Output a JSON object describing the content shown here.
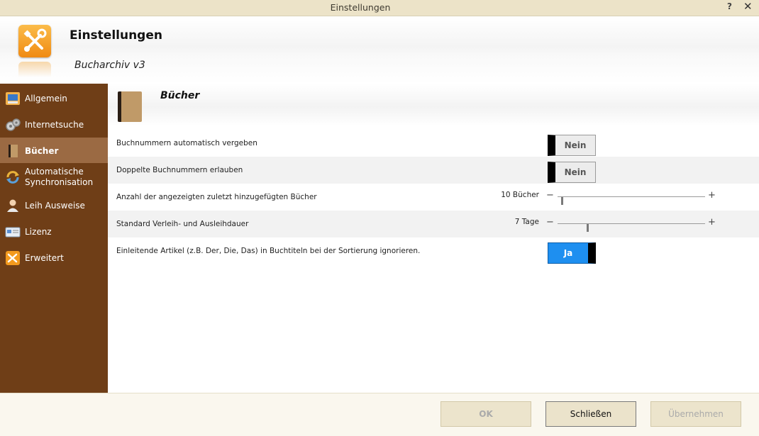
{
  "window": {
    "title": "Einstellungen",
    "help": "?",
    "close": "✕"
  },
  "header": {
    "title": "Einstellungen",
    "subtitle": "Bucharchiv v3"
  },
  "sidebar": {
    "items": [
      {
        "label": "Allgemein",
        "icon": "general-settings-icon"
      },
      {
        "label": "Internetsuche",
        "icon": "internet-search-icon"
      },
      {
        "label": "Bücher",
        "icon": "book-icon",
        "selected": true
      },
      {
        "label": "Automatische Synchronisation",
        "icon": "sync-icon"
      },
      {
        "label": "Leih Ausweise",
        "icon": "user-icon"
      },
      {
        "label": "Lizenz",
        "icon": "license-icon"
      },
      {
        "label": "Erweitert",
        "icon": "tools-icon"
      }
    ]
  },
  "section": {
    "title": "Bücher",
    "icon": "book-icon"
  },
  "settings": [
    {
      "label": "Buchnummern automatisch vergeben",
      "type": "toggle",
      "value": "Nein",
      "on": false
    },
    {
      "label": "Doppelte Buchnummern erlauben",
      "type": "toggle",
      "value": "Nein",
      "on": false
    },
    {
      "label": "Anzahl der angezeigten zuletzt hinzugefügten Bücher",
      "type": "slider",
      "value_text": "10 Bücher",
      "fraction": 0.03
    },
    {
      "label": "Standard Verleih- und Ausleihdauer",
      "type": "slider",
      "value_text": "7 Tage",
      "fraction": 0.2
    },
    {
      "label": "Einleitende Artikel (z.B. Der, Die, Das) in Buchtiteln bei der Sortierung ignorieren.",
      "type": "toggle",
      "value": "Ja",
      "on": true
    }
  ],
  "slider_symbols": {
    "minus": "−",
    "plus": "+"
  },
  "footer": {
    "ok": "OK",
    "close": "Schließen",
    "apply": "Übernehmen"
  },
  "colors": {
    "sidebar": "#6f3e17",
    "sidebar_selected": "#9b6a43",
    "toggle_on": "#1e8ff0",
    "accent": "#f08a12"
  }
}
